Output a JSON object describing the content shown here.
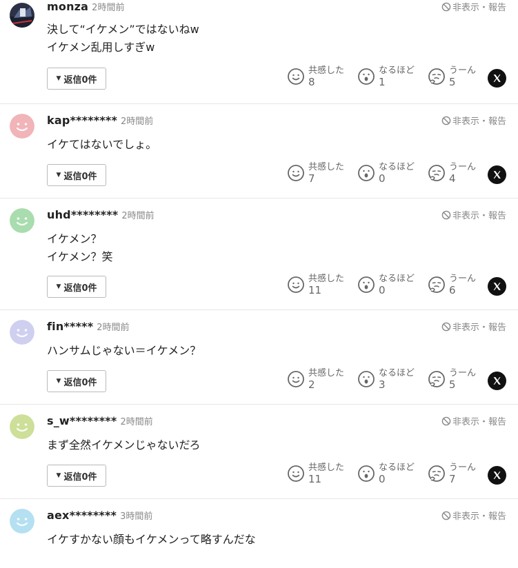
{
  "report_label": "非表示・報告",
  "reply_label": "返信0件",
  "reaction_labels": {
    "empathy": "共感した",
    "agree": "なるほど",
    "hmm": "うーん"
  },
  "comments": [
    {
      "username": "monza",
      "time": "2時間前",
      "lines": "決して“イケメン”ではないねw\nイケメン乱用しすぎw",
      "avatar_color": "#2c3148",
      "empathy": "8",
      "agree": "1",
      "hmm": "5"
    },
    {
      "username": "kap********",
      "time": "2時間前",
      "lines": "イケてはないでしょ。",
      "avatar_color": "#f1b4b8",
      "empathy": "7",
      "agree": "0",
      "hmm": "4"
    },
    {
      "username": "uhd********",
      "time": "2時間前",
      "lines": "イケメン？\nイケメン？笑",
      "avatar_color": "#a9dcae",
      "empathy": "11",
      "agree": "0",
      "hmm": "6"
    },
    {
      "username": "fin*****",
      "time": "2時間前",
      "lines": "ハンサムじゃない＝イケメン？",
      "avatar_color": "#cfcff0",
      "empathy": "2",
      "agree": "3",
      "hmm": "5"
    },
    {
      "username": "s_w********",
      "time": "2時間前",
      "lines": "まず全然イケメンじゃないだろ",
      "avatar_color": "#cddf98",
      "empathy": "11",
      "agree": "0",
      "hmm": "7"
    },
    {
      "username": "aex********",
      "time": "3時間前",
      "lines": "イケすかない顔もイケメンって略すんだな",
      "avatar_color": "#b4e0f1"
    }
  ]
}
